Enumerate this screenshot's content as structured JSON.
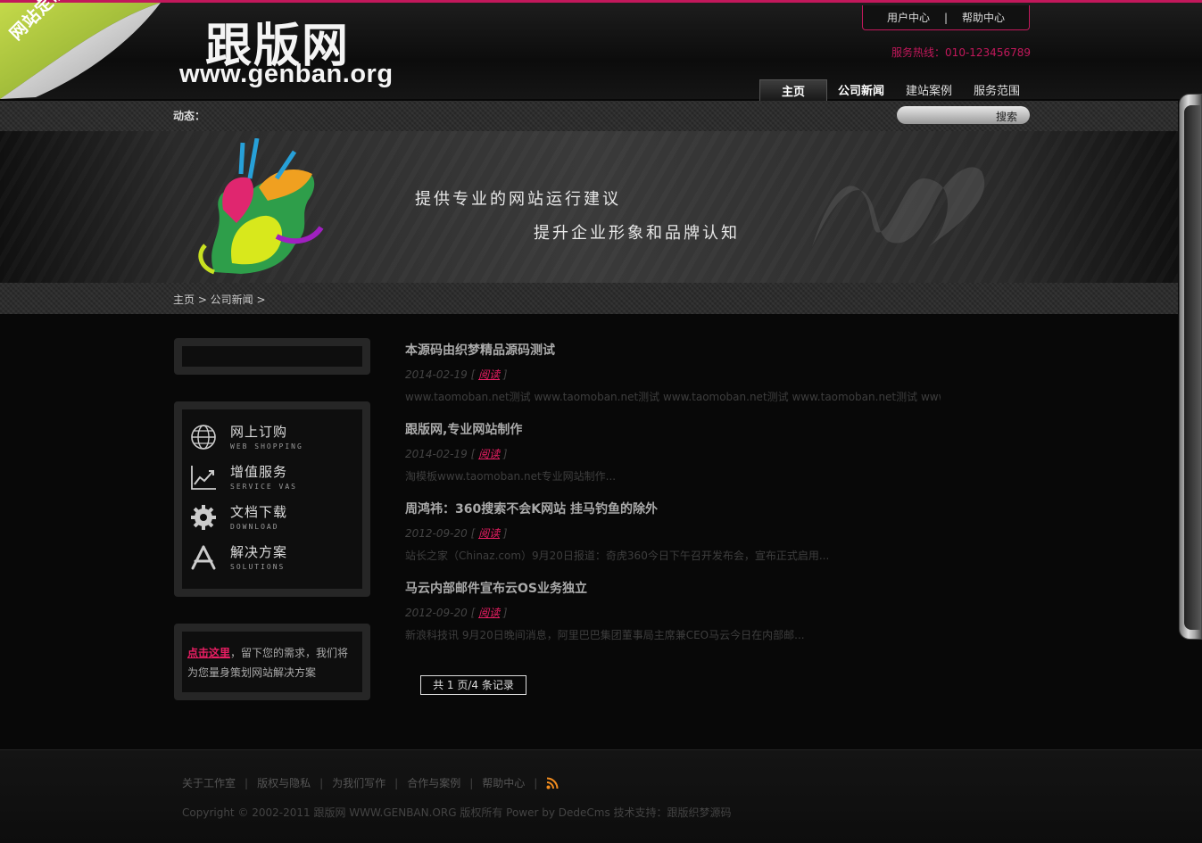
{
  "corner_badge": "网站定制",
  "logo": {
    "name": "跟版网",
    "url": "www.genban.org"
  },
  "top_links": {
    "user_center": "用户中心",
    "separator": "|",
    "help_center": "帮助中心"
  },
  "hotline": "服务热线：010-123456789",
  "nav": {
    "items": [
      {
        "label": "主页"
      },
      {
        "label": "公司新闻"
      },
      {
        "label": "建站案例"
      },
      {
        "label": "服务范围"
      }
    ]
  },
  "ticker_label": "动态：",
  "search": {
    "button": "搜索"
  },
  "banner": {
    "slogan1": "提供专业的网站运行建议",
    "slogan2": "提升企业形象和品牌认知"
  },
  "breadcrumb": "主页 > 公司新闻 >",
  "services": [
    {
      "title": "网上订购",
      "subtitle": "WEB SHOPPING",
      "icon": "globe-icon"
    },
    {
      "title": "增值服务",
      "subtitle": "SERVICE VAS",
      "icon": "chart-icon"
    },
    {
      "title": "文档下载",
      "subtitle": "DOWNLOAD",
      "icon": "gear-icon"
    },
    {
      "title": "解决方案",
      "subtitle": "SOLUTIONS",
      "icon": "app-store-icon"
    }
  ],
  "contact": {
    "link": "点击这里",
    "text": "，留下您的需求，我们将为您量身策划网站解决方案"
  },
  "articles": [
    {
      "title": "本源码由织梦精品源码测试",
      "date": "2014-02-19",
      "read": "阅读",
      "desc": "www.taomoban.net测试 www.taomoban.net测试 www.taomoban.net测试 www.taomoban.net测试 www.t..."
    },
    {
      "title": "跟版网,专业网站制作",
      "date": "2014-02-19",
      "read": "阅读",
      "desc": "淘模板www.taomoban.net专业网站制作..."
    },
    {
      "title": "周鸿祎：360搜索不会K网站 挂马钓鱼的除外",
      "date": "2012-09-20",
      "read": "阅读",
      "desc": "站长之家（Chinaz.com）9月20日报道：奇虎360今日下午召开发布会，宣布正式启用..."
    },
    {
      "title": "马云内部邮件宣布云OS业务独立",
      "date": "2012-09-20",
      "read": "阅读",
      "desc": "新浪科技讯 9月20日晚间消息，阿里巴巴集团董事局主席兼CEO马云今日在内部邮..."
    }
  ],
  "pager": "共 1 页/4 条记录",
  "footer": {
    "links": [
      "关于工作室",
      "版权与隐私",
      "为我们写作",
      "合作与案例",
      "帮助中心"
    ],
    "copyright": "Copyright © 2002-2011 跟版网 WWW.GENBAN.ORG 版权所有 Power by DedeCms 技术支持：跟版织梦源码"
  },
  "colors": {
    "accent": "#c2185b",
    "link": "#e91e63"
  }
}
